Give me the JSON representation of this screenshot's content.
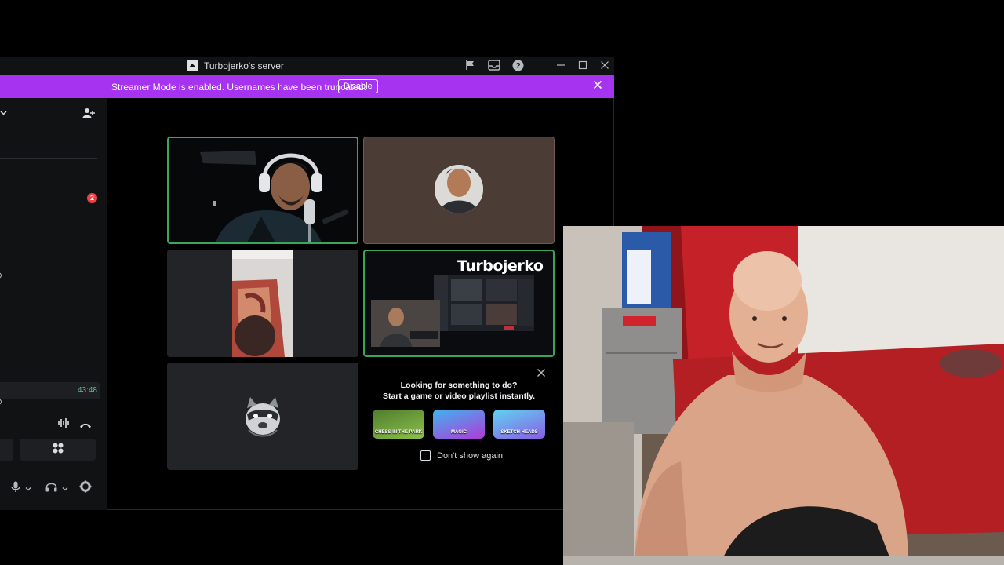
{
  "window": {
    "title": "Turbojerko's server"
  },
  "banner": {
    "message": "Streamer Mode is enabled. Usernames have been truncated.",
    "disable_label": "Disable",
    "color": "#a633f0"
  },
  "sidebar": {
    "notification_count": "2",
    "call_timer": "43:48"
  },
  "grid": {
    "speaking_color": "#3ba55c",
    "stream_label": "Turbojerko"
  },
  "activity_suggestion": {
    "title_line1": "Looking for something to do?",
    "title_line2": "Start a game or video playlist instantly.",
    "activities": [
      {
        "name": "Chess in the Park",
        "thumb_text": "CHESS IN THE PARK"
      },
      {
        "name": "Magic",
        "thumb_text": "MAGIC"
      },
      {
        "name": "Sketch Heads",
        "thumb_text": "SKETCH HEADS"
      }
    ],
    "dont_show_label": "Don't show again"
  },
  "icons": {
    "title_bar": [
      "flag-icon",
      "inbox-icon",
      "help-icon"
    ],
    "window_controls": [
      "minimize-icon",
      "maximize-icon",
      "close-icon"
    ],
    "sidebar": [
      "chevron-down-icon",
      "add-user-icon",
      "soundwave-icon",
      "hangup-icon",
      "activities-icon",
      "microphone-icon",
      "headset-icon",
      "gear-icon"
    ]
  }
}
